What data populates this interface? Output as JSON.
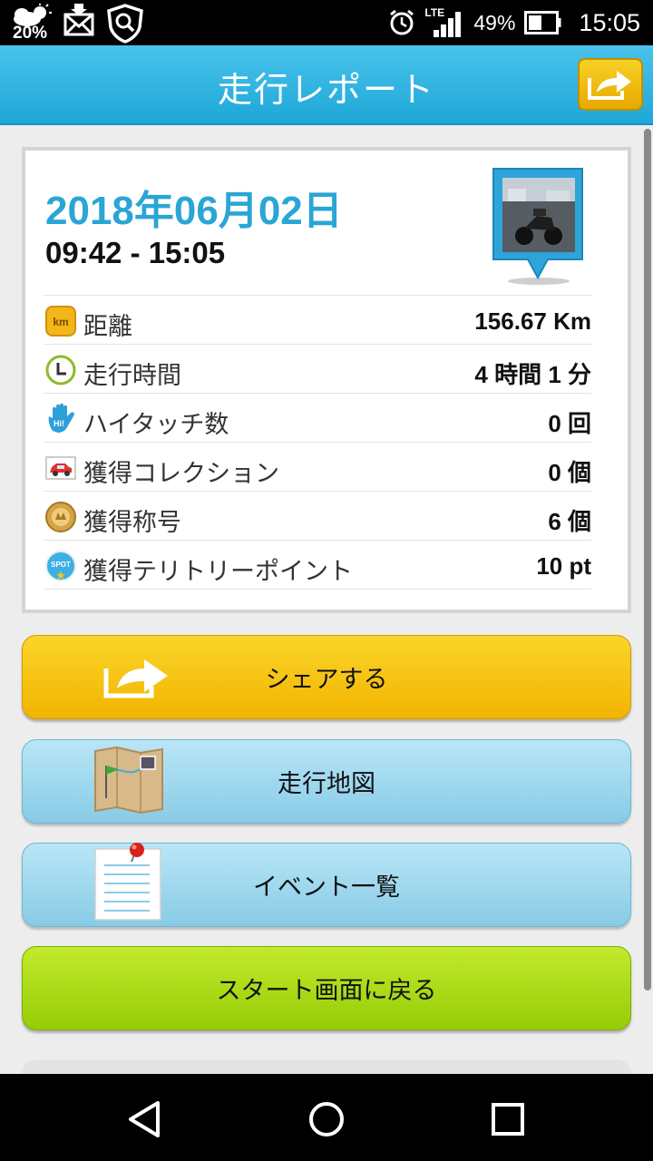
{
  "status_bar": {
    "weather_temp": "20%",
    "battery_percent": "49%",
    "network": "LTE",
    "time": "15:05",
    "icons": [
      "cloud-sun-icon",
      "mail-muted-icon",
      "shield-search-icon",
      "alarm-icon",
      "signal-icon",
      "battery-icon"
    ]
  },
  "header": {
    "title": "走行レポート",
    "share_icon": "share-arrow-icon"
  },
  "report": {
    "date": "2018年06月02日",
    "time_range": "09:42 - 15:05",
    "stats": [
      {
        "icon": "km-icon",
        "label": "距離",
        "value": "156.67 Km"
      },
      {
        "icon": "clock-icon",
        "label": "走行時間",
        "value": "4 時間 1 分"
      },
      {
        "icon": "hi-touch-hand-icon",
        "label": "ハイタッチ数",
        "value": "0 回"
      },
      {
        "icon": "car-collection-icon",
        "label": "獲得コレクション",
        "value": "0 個"
      },
      {
        "icon": "medal-icon",
        "label": "獲得称号",
        "value": "6 個"
      },
      {
        "icon": "spot-icon",
        "label": "獲得テリトリーポイント",
        "value": "10 pt"
      }
    ]
  },
  "buttons": {
    "share": "シェアする",
    "map": "走行地図",
    "events": "イベント一覧",
    "back_to_start": "スタート画面に戻る"
  },
  "colors": {
    "header": "#1ea7d8",
    "date": "#2aa6d5",
    "share_button": "#f1b400",
    "blue_button": "#88cbe6",
    "green_button": "#96cc06"
  }
}
